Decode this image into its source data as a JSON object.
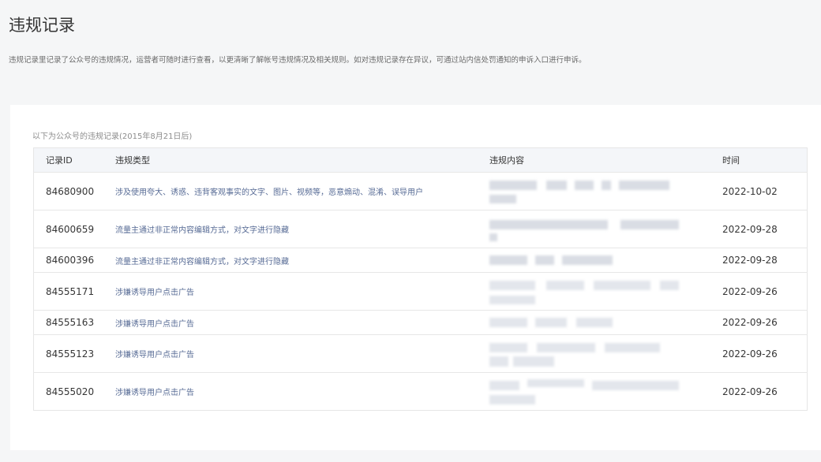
{
  "page": {
    "title": "违规记录",
    "description": "违规记录里记录了公众号的违规情况，运营者可随时进行查看，以更清晰了解帐号违规情况及相关规则。如对违规记录存在异议，可通过站内信处罚通知的申诉入口进行申诉。"
  },
  "table": {
    "caption": "以下为公众号的违规记录(2015年8月21日后)",
    "headers": {
      "id": "记录ID",
      "type": "违规类型",
      "content": "违规内容",
      "time": "时间"
    },
    "rows": [
      {
        "id": "84680900",
        "type": "涉及使用夸大、诱惑、违背客观事实的文字、图片、视频等，恶意煽动、混淆、误导用户",
        "time": "2022-10-02"
      },
      {
        "id": "84600659",
        "type": "流量主通过非正常内容编辑方式，对文字进行隐藏",
        "time": "2022-09-28"
      },
      {
        "id": "84600396",
        "type": "流量主通过非正常内容编辑方式，对文字进行隐藏",
        "time": "2022-09-28"
      },
      {
        "id": "84555171",
        "type": "涉嫌诱导用户点击广告",
        "time": "2022-09-26"
      },
      {
        "id": "84555163",
        "type": "涉嫌诱导用户点击广告",
        "time": "2022-09-26"
      },
      {
        "id": "84555123",
        "type": "涉嫌诱导用户点击广告",
        "time": "2022-09-26"
      },
      {
        "id": "84555020",
        "type": "涉嫌诱导用户点击广告",
        "time": "2022-09-26"
      }
    ]
  }
}
